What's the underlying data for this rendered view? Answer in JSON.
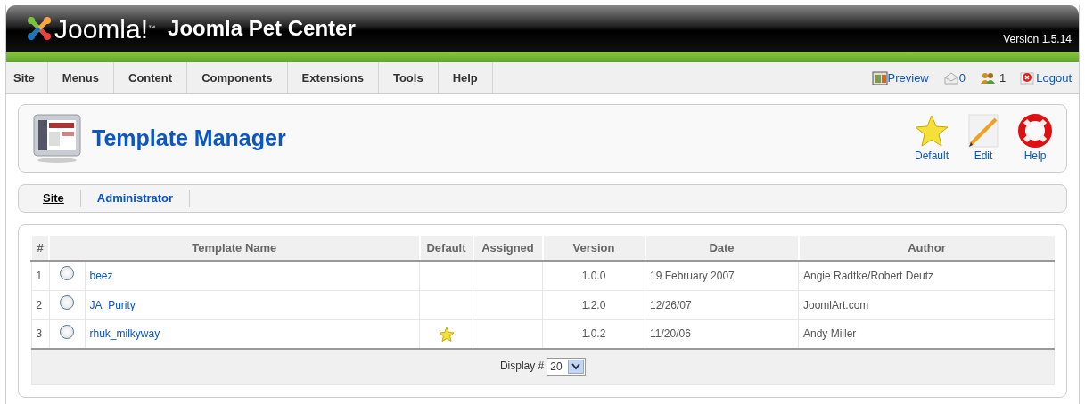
{
  "header": {
    "logo_text": "Joomla!",
    "logo_mark": "™",
    "site_name": "Joomla Pet Center",
    "version": "Version 1.5.14"
  },
  "menu": [
    "Site",
    "Menus",
    "Content",
    "Components",
    "Extensions",
    "Tools",
    "Help"
  ],
  "status": {
    "preview": "Preview",
    "messages": "0",
    "users": "1",
    "logout": "Logout"
  },
  "toolbar": {
    "title": "Template Manager",
    "buttons": [
      {
        "kind": "default",
        "label": "Default"
      },
      {
        "kind": "edit",
        "label": "Edit"
      },
      {
        "kind": "help",
        "label": "Help"
      }
    ]
  },
  "submenu": [
    {
      "label": "Site",
      "selected": true
    },
    {
      "label": "Administrator",
      "selected": false
    }
  ],
  "table": {
    "columns": [
      "#",
      "Template Name",
      "Default",
      "Assigned",
      "Version",
      "Date",
      "Author"
    ],
    "rows": [
      {
        "number": "1",
        "selected": false,
        "name": "beez",
        "default": false,
        "version": "1.0.0",
        "date": "19 February 2007",
        "author": "Angie Radtke/Robert Deutz"
      },
      {
        "number": "2",
        "selected": false,
        "name": "JA_Purity",
        "default": false,
        "version": "1.2.0",
        "date": "12/26/07",
        "author": "JoomlArt.com"
      },
      {
        "number": "3",
        "selected": false,
        "name": "rhuk_milkyway",
        "default": true,
        "version": "1.0.2",
        "date": "11/20/06",
        "author": "Andy Miller"
      }
    ],
    "display_label": "Display #",
    "display_value": "20"
  }
}
